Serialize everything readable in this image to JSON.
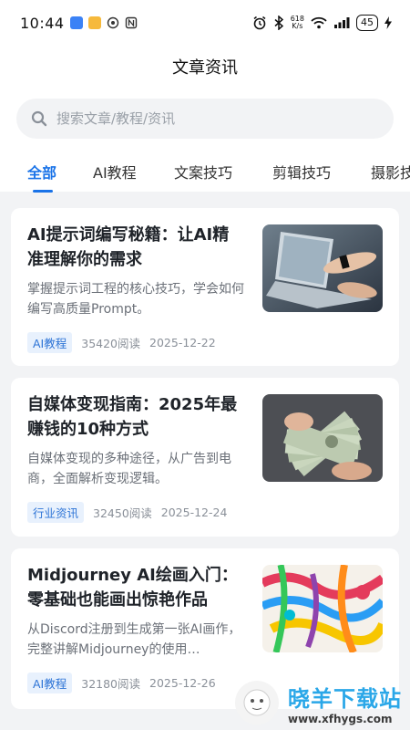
{
  "status": {
    "time": "10:44",
    "speed_value": "618",
    "speed_unit": "K/s",
    "battery": "45"
  },
  "header": {
    "title": "文章资讯",
    "search_placeholder": "搜索文章/教程/资讯"
  },
  "tabs": [
    {
      "label": "全部",
      "active": true
    },
    {
      "label": "AI教程"
    },
    {
      "label": "文案技巧"
    },
    {
      "label": "剪辑技巧"
    },
    {
      "label": "摄影技"
    }
  ],
  "articles": [
    {
      "title": "AI提示词编写秘籍：让AI精准理解你的需求",
      "desc": "掌握提示词工程的核心技巧，学会如何编写高质量Prompt。",
      "tag": "AI教程",
      "reads": "35420阅读",
      "date": "2025-12-22",
      "thumb": "laptop-typing-photo"
    },
    {
      "title": "自媒体变现指南：2025年最赚钱的10种方式",
      "desc": "自媒体变现的多种途径，从广告到电商，全面解析变现逻辑。",
      "tag": "行业资讯",
      "reads": "32450阅读",
      "date": "2025-12-24",
      "thumb": "money-cash-photo"
    },
    {
      "title": "Midjourney AI绘画入门：零基础也能画出惊艳作品",
      "desc": "从Discord注册到生成第一张AI画作，完整讲解Midjourney的使用…",
      "tag": "AI教程",
      "reads": "32180阅读",
      "date": "2025-12-26",
      "thumb": "colorful-paint-photo"
    }
  ],
  "watermark": {
    "main": "晓羊下载站",
    "url": "www.xfhygs.com"
  }
}
